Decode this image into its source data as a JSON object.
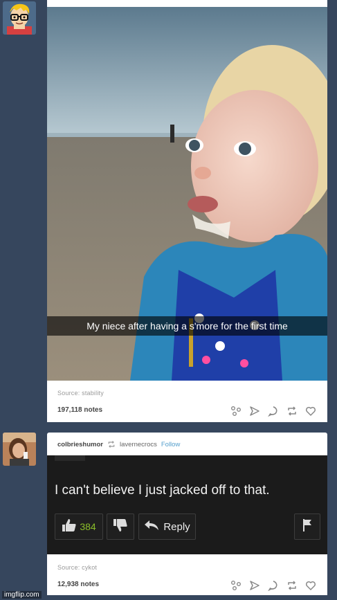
{
  "posts": [
    {
      "avatar": "nerd-cartoon-avatar",
      "photo_caption": "My niece after having a s'more for the first time",
      "source_label": "Source:",
      "source_name": "stability",
      "notes": "197,118 notes"
    },
    {
      "avatar": "user-photo-avatar",
      "username": "colbrieshumor",
      "reblog_icon": "reblog-icon",
      "reblogged_from": "lavernecrocs",
      "follow_label": "Follow",
      "comment_text": "I can't believe I just jacked off to that.",
      "like_count": "384",
      "reply_label": "Reply",
      "source_label": "Source:",
      "source_name": "cykot",
      "notes": "12,938 notes"
    }
  ],
  "action_icons": [
    "share-icon",
    "send-icon",
    "reply-icon",
    "reblog-icon",
    "heart-icon"
  ],
  "colors": {
    "dashboard_bg": "#36465d",
    "link_blue": "#529ecc",
    "like_green": "#8bbf2a"
  },
  "watermark": "imgflip.com"
}
